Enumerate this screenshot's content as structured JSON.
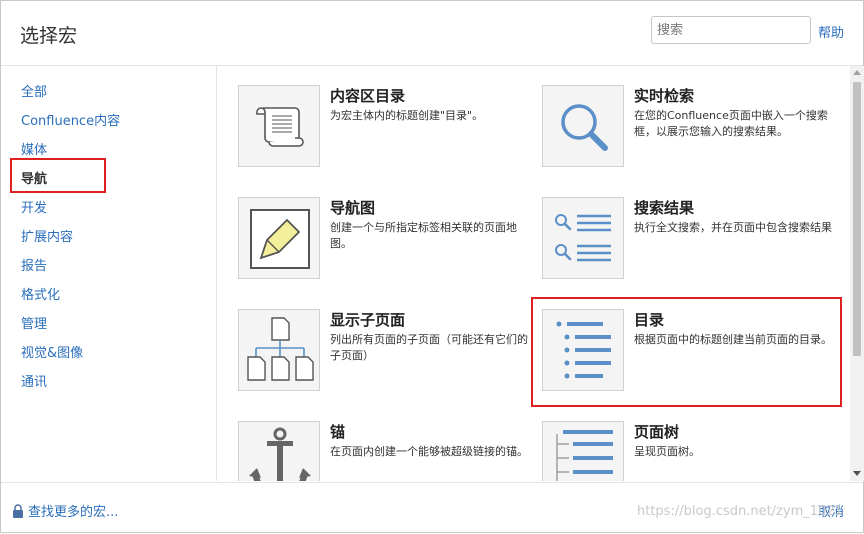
{
  "header": {
    "title": "选择宏",
    "search_placeholder": "搜索",
    "help_label": "帮助"
  },
  "sidebar": {
    "items": [
      {
        "label": "全部"
      },
      {
        "label": "Confluence内容"
      },
      {
        "label": "媒体"
      },
      {
        "label": "导航",
        "active": true
      },
      {
        "label": "开发"
      },
      {
        "label": "扩展内容"
      },
      {
        "label": "报告"
      },
      {
        "label": "格式化"
      },
      {
        "label": "管理"
      },
      {
        "label": "视觉&图像"
      },
      {
        "label": "通讯"
      }
    ]
  },
  "macros": [
    {
      "name": "内容区目录",
      "desc": "为宏主体内的标题创建\"目录\"。",
      "icon": "scroll-icon"
    },
    {
      "name": "实时检索",
      "desc": "在您的Confluence页面中嵌入一个搜索框，以展示您输入的搜索结果。",
      "icon": "magnifier-icon"
    },
    {
      "name": "导航图",
      "desc": "创建一个与所指定标签相关联的页面地图。",
      "icon": "tag-icon"
    },
    {
      "name": "搜索结果",
      "desc": "执行全文搜索，并在页面中包含搜索结果",
      "icon": "search-results-icon"
    },
    {
      "name": "显示子页面",
      "desc": "列出所有页面的子页面（可能还有它们的子页面）",
      "icon": "page-tree-diagram-icon"
    },
    {
      "name": "目录",
      "desc": "根据页面中的标题创建当前页面的目录。",
      "icon": "toc-list-icon"
    },
    {
      "name": "锚",
      "desc": "在页面内创建一个能够被超级链接的锚。",
      "icon": "anchor-icon"
    },
    {
      "name": "页面树",
      "desc": "呈现页面树。",
      "icon": "tree-list-icon"
    }
  ],
  "footer": {
    "more_label": "查找更多的宏...",
    "cancel_label": "取消"
  },
  "watermark": "https://blog.csdn.net/zym_1021",
  "colors": {
    "link": "#2a6ebb",
    "icon_blue": "#5b8fc7",
    "highlight": "#e02020"
  }
}
